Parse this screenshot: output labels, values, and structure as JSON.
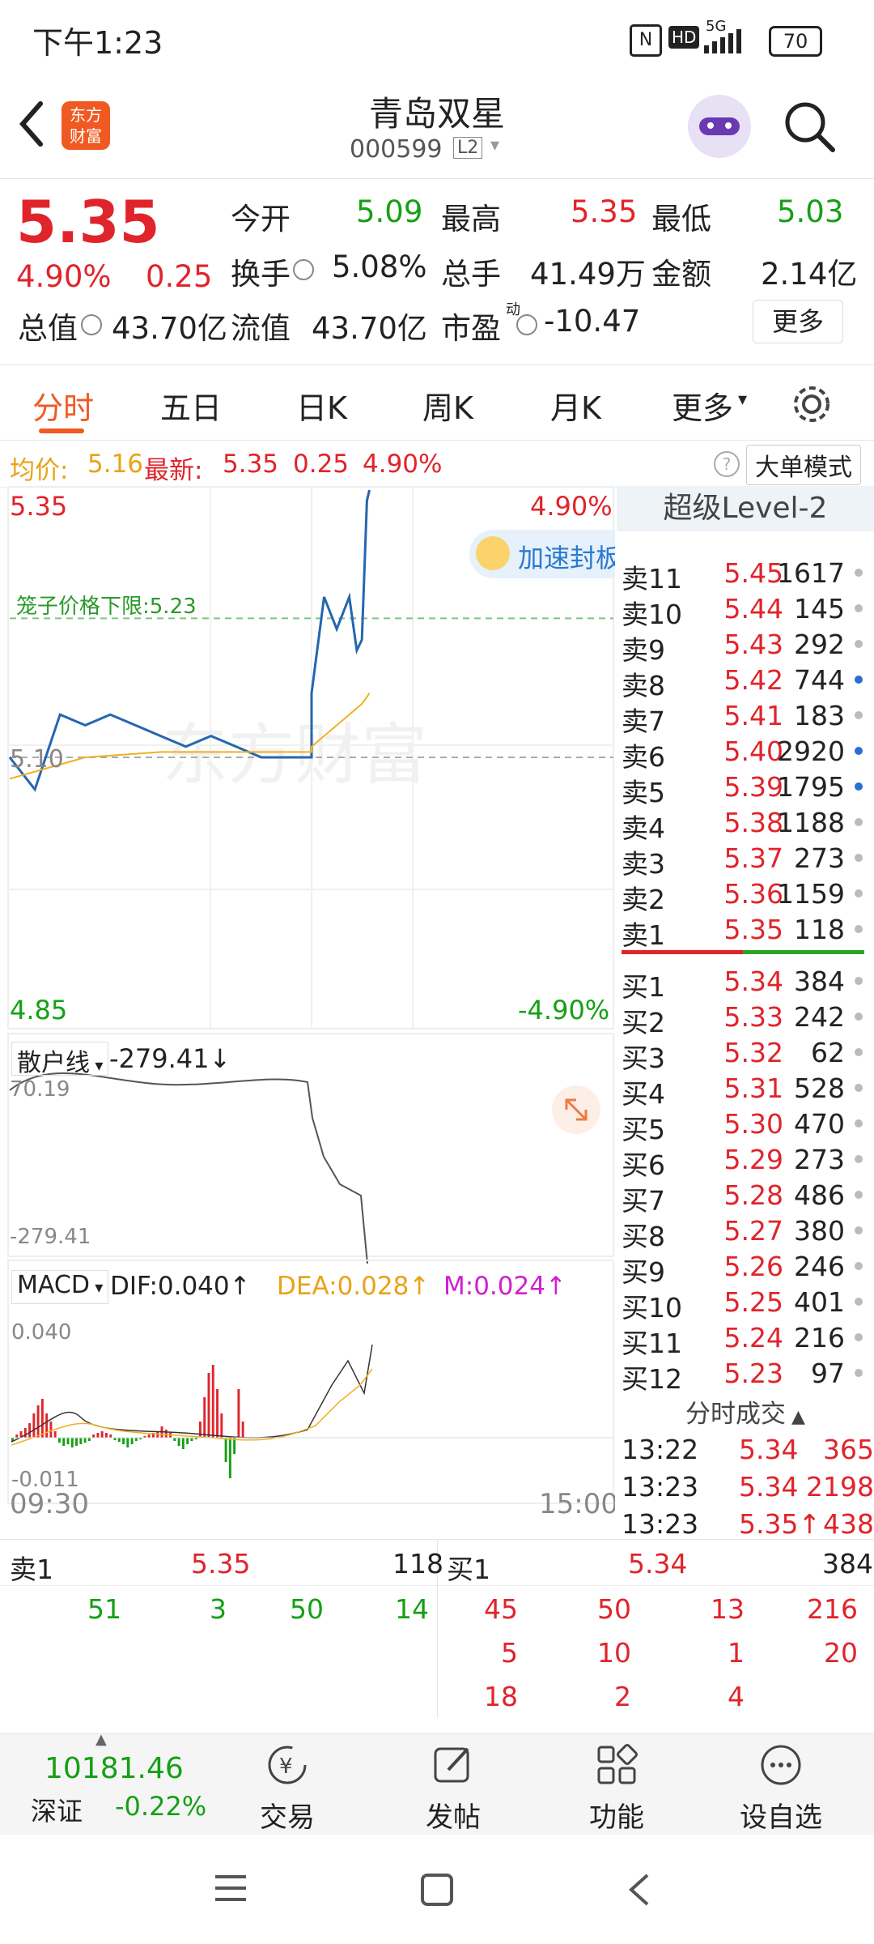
{
  "status": {
    "time": "下午1:23",
    "network": "5G",
    "hd": "HD",
    "battery": "70"
  },
  "header": {
    "logo_line1": "东方",
    "logo_line2": "财富",
    "title": "青岛双星",
    "code": "000599",
    "level_badge": "L2"
  },
  "quote": {
    "price": "5.35",
    "change_pct": "4.90%",
    "change": "0.25",
    "open_label": "今开",
    "open": "5.09",
    "high_label": "最高",
    "high": "5.35",
    "low_label": "最低",
    "low": "5.03",
    "turnover_label": "换手",
    "turnover": "5.08%",
    "volume_label": "总手",
    "volume": "41.49万",
    "amount_label": "金额",
    "amount": "2.14亿",
    "mktcap_label": "总值",
    "mktcap": "43.70亿",
    "float_label": "流值",
    "float": "43.70亿",
    "pe_label": "市盈",
    "pe_sup": "动",
    "pe": "-10.47",
    "more_button": "更多"
  },
  "tabs": [
    {
      "label": "分时",
      "active": true
    },
    {
      "label": "五日"
    },
    {
      "label": "日K"
    },
    {
      "label": "周K"
    },
    {
      "label": "月K"
    },
    {
      "label": "更多"
    }
  ],
  "infoline": {
    "avg_label": "均价:",
    "avg": "5.16",
    "latest_label": "最新:",
    "latest": "5.35",
    "latest_chg": "0.25",
    "latest_pct": "4.90%",
    "mode_button": "大单模式"
  },
  "chart": {
    "price_top": "5.35",
    "pct_top": "4.90%",
    "price_bottom": "4.85",
    "pct_bottom": "-4.90%",
    "mid_price": "5.10",
    "cage_label": "笼子价格下限:",
    "cage_value": "5.23",
    "watermark": "东方财富",
    "accelerate_label": "加速封板",
    "time_start": "09:30",
    "time_end": "15:00"
  },
  "retail": {
    "selector": "散户线",
    "value": "-279.41↓",
    "top": "70.19",
    "bottom": "-279.41"
  },
  "macd": {
    "selector": "MACD",
    "dif": "DIF:0.040↑",
    "dea": "DEA:0.028↑",
    "m": "M:0.024↑",
    "top": "0.040",
    "bottom": "-0.011"
  },
  "level2": {
    "title": "超级Level-2",
    "asks": [
      {
        "label": "卖11",
        "price": "5.45",
        "vol": "1617",
        "dot": "gray"
      },
      {
        "label": "卖10",
        "price": "5.44",
        "vol": "145",
        "dot": "gray"
      },
      {
        "label": "卖9",
        "price": "5.43",
        "vol": "292",
        "dot": "gray"
      },
      {
        "label": "卖8",
        "price": "5.42",
        "vol": "744",
        "dot": "blue"
      },
      {
        "label": "卖7",
        "price": "5.41",
        "vol": "183",
        "dot": "gray"
      },
      {
        "label": "卖6",
        "price": "5.40",
        "vol": "2920",
        "dot": "blue"
      },
      {
        "label": "卖5",
        "price": "5.39",
        "vol": "1795",
        "dot": "blue"
      },
      {
        "label": "卖4",
        "price": "5.38",
        "vol": "1188",
        "dot": "gray"
      },
      {
        "label": "卖3",
        "price": "5.37",
        "vol": "273",
        "dot": "gray"
      },
      {
        "label": "卖2",
        "price": "5.36",
        "vol": "1159",
        "dot": "gray"
      },
      {
        "label": "卖1",
        "price": "5.35",
        "vol": "118",
        "dot": "gray"
      }
    ],
    "bids": [
      {
        "label": "买1",
        "price": "5.34",
        "vol": "384",
        "dot": "gray"
      },
      {
        "label": "买2",
        "price": "5.33",
        "vol": "242",
        "dot": "gray"
      },
      {
        "label": "买3",
        "price": "5.32",
        "vol": "62",
        "dot": "gray"
      },
      {
        "label": "买4",
        "price": "5.31",
        "vol": "528",
        "dot": "gray"
      },
      {
        "label": "买5",
        "price": "5.30",
        "vol": "470",
        "dot": "gray"
      },
      {
        "label": "买6",
        "price": "5.29",
        "vol": "273",
        "dot": "gray"
      },
      {
        "label": "买7",
        "price": "5.28",
        "vol": "486",
        "dot": "gray"
      },
      {
        "label": "买8",
        "price": "5.27",
        "vol": "380",
        "dot": "gray"
      },
      {
        "label": "买9",
        "price": "5.26",
        "vol": "246",
        "dot": "gray"
      },
      {
        "label": "买10",
        "price": "5.25",
        "vol": "401",
        "dot": "gray"
      },
      {
        "label": "买11",
        "price": "5.24",
        "vol": "216",
        "dot": "gray"
      },
      {
        "label": "买12",
        "price": "5.23",
        "vol": "97",
        "dot": "gray"
      }
    ],
    "trades_title": "分时成交",
    "trades": [
      {
        "time": "13:22",
        "price": "5.34",
        "vol": "365"
      },
      {
        "time": "13:23",
        "price": "5.34",
        "vol": "2198"
      },
      {
        "time": "13:23",
        "price": "5.35↑",
        "vol": "438"
      }
    ]
  },
  "bottom_table": {
    "sell_label": "卖1",
    "sell_price": "5.35",
    "sell_vol": "118",
    "buy_label": "买1",
    "buy_price": "5.34",
    "buy_vol": "384",
    "sell_queue": [
      "51",
      "3",
      "50",
      "14"
    ],
    "buy_queue": [
      [
        "45",
        "50",
        "13",
        "216"
      ],
      [
        "5",
        "10",
        "1",
        "20"
      ],
      [
        "18",
        "2",
        "4"
      ]
    ]
  },
  "bottom_nav": {
    "index_value": "10181.46",
    "index_name": "深证",
    "index_chg": "-0.22%",
    "items": [
      {
        "label": "交易",
        "icon": "yen-exchange-icon"
      },
      {
        "label": "发帖",
        "icon": "edit-icon"
      },
      {
        "label": "功能",
        "icon": "grid-icon"
      },
      {
        "label": "设自选",
        "icon": "more-dots-icon"
      }
    ]
  },
  "chart_data": [
    {
      "type": "line",
      "title": "",
      "series": [
        {
          "name": "最新",
          "x": [
            "09:30",
            "09:40",
            "09:50",
            "10:00",
            "10:10",
            "10:20",
            "10:30",
            "10:40",
            "10:50",
            "11:00",
            "11:10",
            "11:20",
            "11:30",
            "13:00",
            "13:05",
            "13:10",
            "13:15",
            "13:18",
            "13:20",
            "13:22",
            "13:23"
          ],
          "values": [
            5.1,
            5.07,
            5.14,
            5.13,
            5.14,
            5.13,
            5.12,
            5.11,
            5.12,
            5.11,
            5.1,
            5.1,
            5.1,
            5.16,
            5.25,
            5.22,
            5.25,
            5.2,
            5.21,
            5.34,
            5.35
          ]
        },
        {
          "name": "均价",
          "x": [
            "09:30",
            "10:00",
            "10:30",
            "11:00",
            "11:30",
            "13:00",
            "13:10",
            "13:20",
            "13:23"
          ],
          "values": [
            5.08,
            5.1,
            5.105,
            5.105,
            5.105,
            5.11,
            5.13,
            5.15,
            5.16
          ]
        }
      ],
      "ylim": [
        4.85,
        5.35
      ],
      "reference": 5.1,
      "cage_lower_limit": 5.23
    }
  ]
}
